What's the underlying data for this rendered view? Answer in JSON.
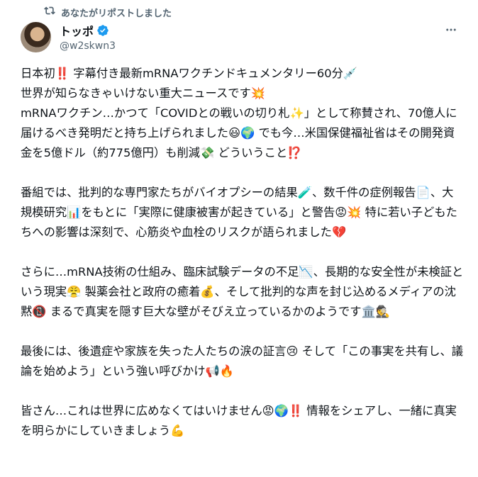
{
  "repost": {
    "icon": "repost-icon",
    "label": "あなたがリポストしました"
  },
  "author": {
    "name": "トッポ",
    "handle": "@w2skwn3",
    "verified_icon": "verified-badge-icon",
    "verified_color": "#1d9bf0"
  },
  "menu": {
    "icon": "more-options-icon"
  },
  "post": {
    "paragraphs": [
      "日本初‼️ 字幕付き最新mRNAワクチンドキュメンタリー60分💉\n世界が知らなきゃいけない重大ニュースです💥\nmRNAワクチン…かつて「COVIDとの戦いの切り札✨」として称賛され、70億人に届けるべき発明だと持ち上げられました😃🌍 でも今…米国保健福祉省はその開発資金を5億ドル（約775億円）も削減💸 どういうこと⁉️",
      "番組では、批判的な専門家たちがバイオプシーの結果🧪、数千件の症例報告📄、大規模研究📊をもとに「実際に健康被害が起きている」と警告😡💥 特に若い子どもたちへの影響は深刻で、心筋炎や血栓のリスクが語られました💔",
      "さらに…mRNA技術の仕組み、臨床試験データの不足📉、長期的な安全性が未検証という現実😤 製薬会社と政府の癒着💰、そして批判的な声を封じ込めるメディアの沈黙📵 まるで真実を隠す巨大な壁がそびえ立っているかのようです🏛️🕵️",
      "最後には、後遺症や家族を失った人たちの涙の証言😢 そして「この事実を共有し、議論を始めよう」という強い呼びかけ📢🔥",
      "皆さん…これは世界に広めなくてはいけません😡🌍‼️ 情報をシェアし、一緒に真実を明らかにしていきましょう💪"
    ]
  }
}
